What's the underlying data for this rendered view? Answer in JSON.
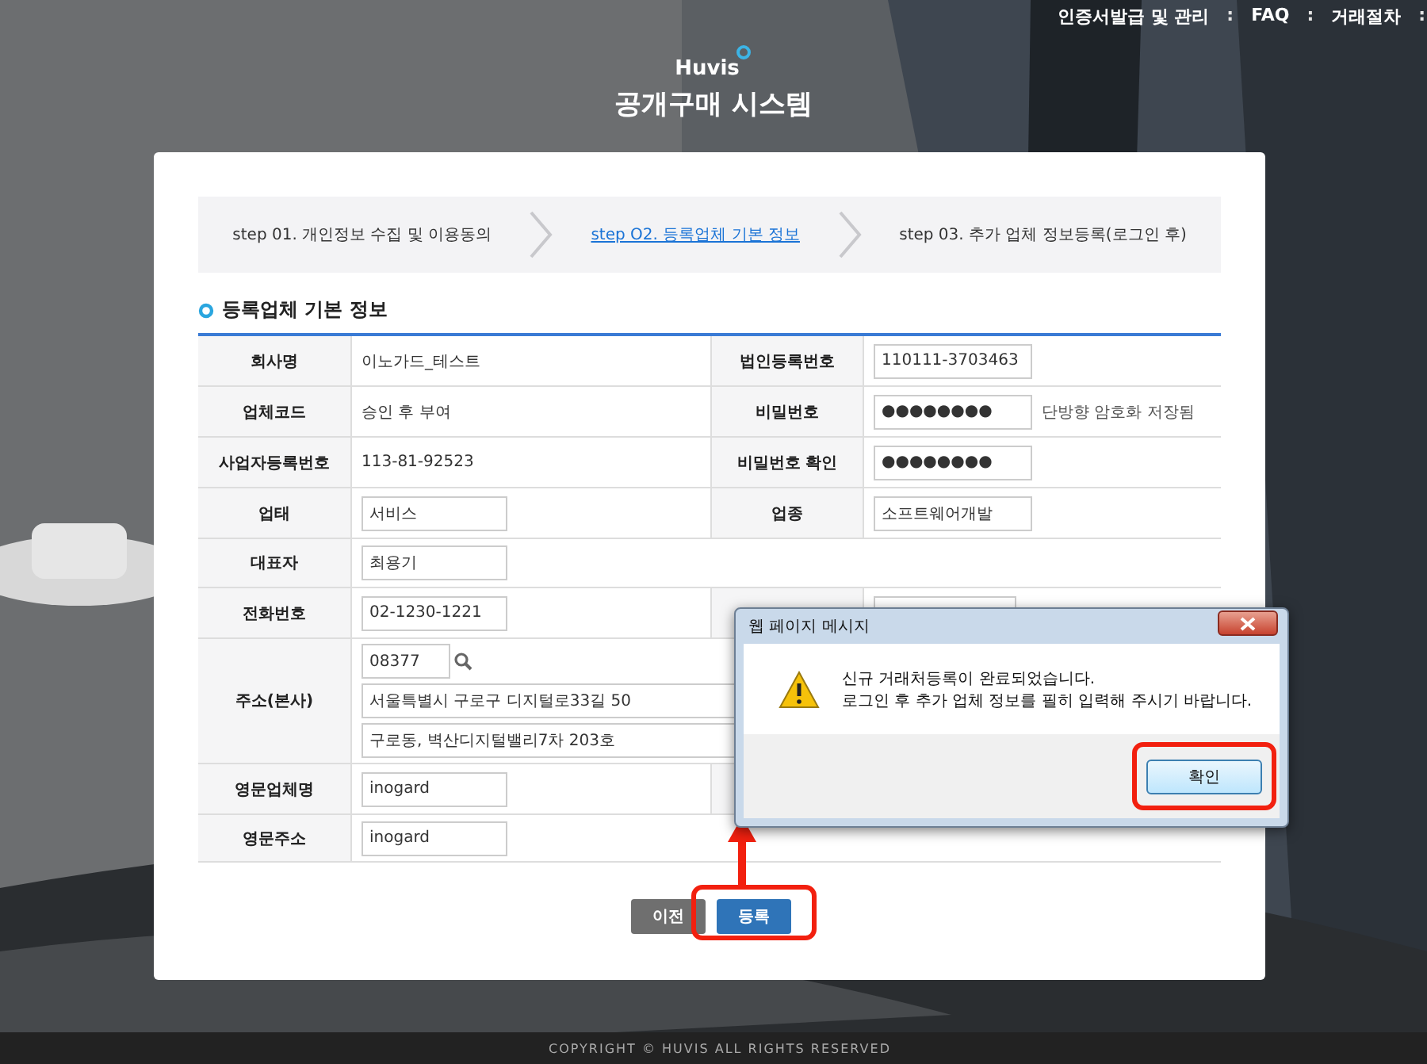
{
  "top_nav": [
    {
      "kind": "link",
      "text": "인증서발급 및 관리"
    },
    {
      "kind": "separator",
      "text": ":"
    },
    {
      "kind": "link",
      "text": "FAQ"
    },
    {
      "kind": "separator",
      "text": ":"
    },
    {
      "kind": "link",
      "text": "거래절차"
    },
    {
      "kind": "separator",
      "text": ":"
    }
  ],
  "logo": {
    "brand": "Huvis",
    "title": "공개구매 시스템"
  },
  "steps": [
    {
      "label": "step 01. 개인정보 수집 및 이용동의",
      "selected": false
    },
    {
      "label": "step O2. 등록업체 기본 정보",
      "selected": true
    },
    {
      "label": "step 03. 추가 업체 정보등록(로그인 후)",
      "selected": false
    }
  ],
  "section_title": "등록업체 기본 정보",
  "form_rows": [
    {
      "fields": [
        {
          "kind": "text",
          "label": "회사명",
          "value": "이노가드_테스트"
        },
        {
          "kind": "input",
          "label": "법인등록번호",
          "value": "110111-3703463"
        }
      ]
    },
    {
      "fields": [
        {
          "kind": "text",
          "label": "업체코드",
          "value": "승인 후 부여"
        },
        {
          "kind": "password",
          "label": "비밀번호",
          "value": "●●●●●●●●",
          "note": "단방향 암호화 저장됨"
        }
      ]
    },
    {
      "fields": [
        {
          "kind": "text",
          "label": "사업자등록번호",
          "value": "113-81-92523"
        },
        {
          "kind": "password",
          "label": "비밀번호 확인",
          "value": "●●●●●●●●"
        }
      ]
    },
    {
      "fields": [
        {
          "kind": "input",
          "label": "업태",
          "value": "서비스"
        },
        {
          "kind": "input",
          "label": "업종",
          "value": "소프트웨어개발"
        }
      ]
    },
    {
      "fields": [
        {
          "kind": "input",
          "label": "대표자",
          "value": "최용기"
        }
      ]
    },
    {
      "fields": [
        {
          "kind": "input",
          "label": "전화번호",
          "value": "02-1230-1221"
        },
        {
          "kind": "covered-input"
        }
      ]
    },
    {
      "fields": [
        {
          "kind": "address",
          "label": "주소(본사)",
          "zip": "08377",
          "lines": [
            "서울특별시 구로구 디지털로33길 50",
            "구로동, 벽산디지털밸리7차 203호"
          ]
        }
      ]
    },
    {
      "fields": [
        {
          "kind": "input",
          "label": "영문업체명",
          "value": "inogard"
        },
        {
          "kind": "covered"
        }
      ]
    },
    {
      "fields": [
        {
          "kind": "input",
          "label": "영문주소",
          "value": "inogard"
        }
      ]
    }
  ],
  "buttons": [
    {
      "label": "이전",
      "kind": "secondary",
      "highlighted": false
    },
    {
      "label": "등록",
      "kind": "primary",
      "highlighted": true
    }
  ],
  "dialog": {
    "title": "웹 페이지 메시지",
    "message": [
      "신규 거래처등록이 완료되었습니다.",
      "로그인 후 추가 업체 정보를 필히 입력해 주시기 바랍니다."
    ],
    "button": "확인",
    "button_highlighted": true
  },
  "footer": "COPYRIGHT © HUVIS ALL RIGHTS RESERVED"
}
